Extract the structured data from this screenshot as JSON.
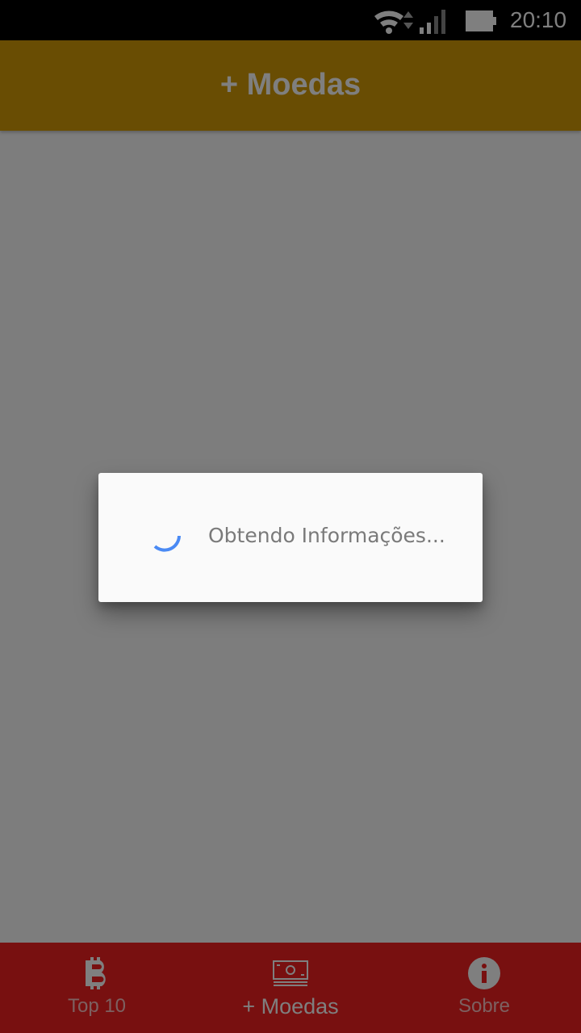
{
  "status_bar": {
    "time": "20:10",
    "icons": [
      "wifi-icon",
      "signal-icon",
      "battery-icon"
    ]
  },
  "app_bar": {
    "title": "+ Moedas",
    "color": "#d39a07"
  },
  "bottom_nav": {
    "color": "#f02020",
    "items": [
      {
        "label": "Top 10",
        "icon": "bitcoin-icon",
        "active": false
      },
      {
        "label": "+ Moedas",
        "icon": "money-icon",
        "active": true
      },
      {
        "label": "Sobre",
        "icon": "info-icon",
        "active": false
      }
    ]
  },
  "dialog": {
    "message": "Obtendo Informações...",
    "spinner_color": "#4a8af4"
  }
}
